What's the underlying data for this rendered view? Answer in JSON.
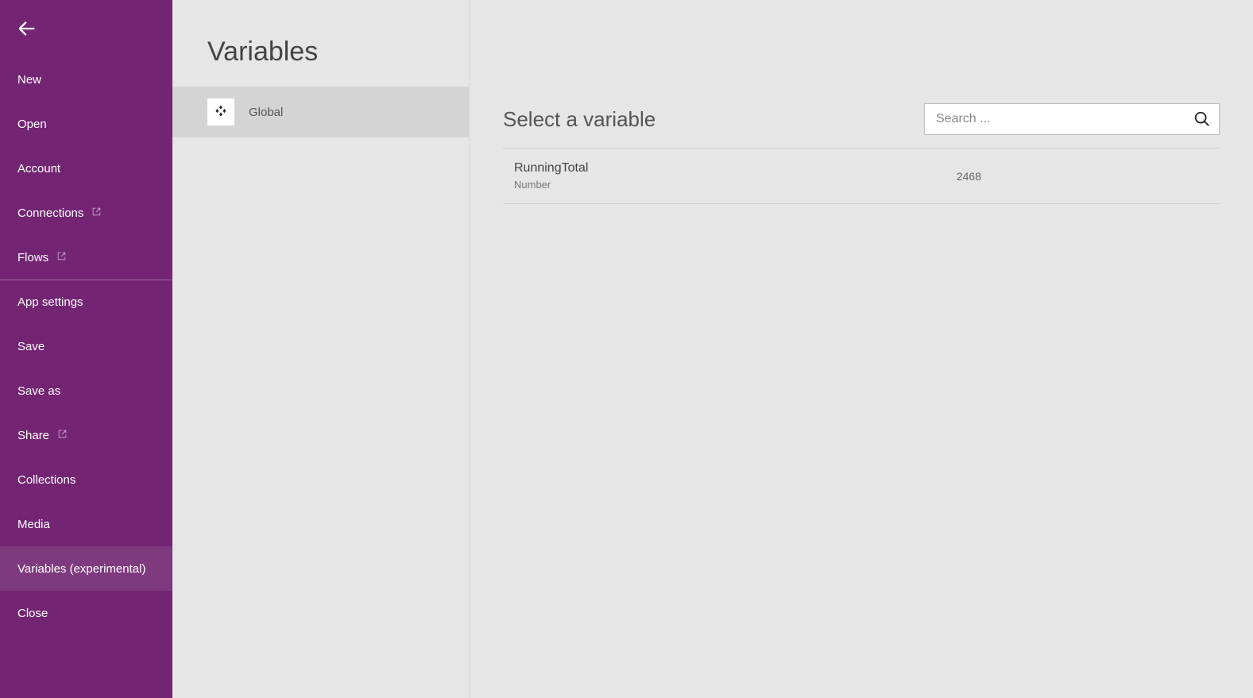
{
  "sidebar": {
    "items": [
      {
        "label": "New",
        "external": false
      },
      {
        "label": "Open",
        "external": false
      },
      {
        "label": "Account",
        "external": false
      },
      {
        "label": "Connections",
        "external": true
      },
      {
        "label": "Flows",
        "external": true
      },
      {
        "label": "App settings",
        "external": false,
        "section_top": true
      },
      {
        "label": "Save",
        "external": false
      },
      {
        "label": "Save as",
        "external": false
      },
      {
        "label": "Share",
        "external": true
      },
      {
        "label": "Collections",
        "external": false
      },
      {
        "label": "Media",
        "external": false
      },
      {
        "label": "Variables (experimental)",
        "external": false,
        "active": true
      },
      {
        "label": "Close",
        "external": false
      }
    ]
  },
  "midcol": {
    "title": "Variables",
    "scope_label": "Global"
  },
  "main": {
    "title": "Select a variable",
    "search_placeholder": "Search ...",
    "variables": [
      {
        "name": "RunningTotal",
        "type": "Number",
        "value": "2468"
      }
    ]
  }
}
